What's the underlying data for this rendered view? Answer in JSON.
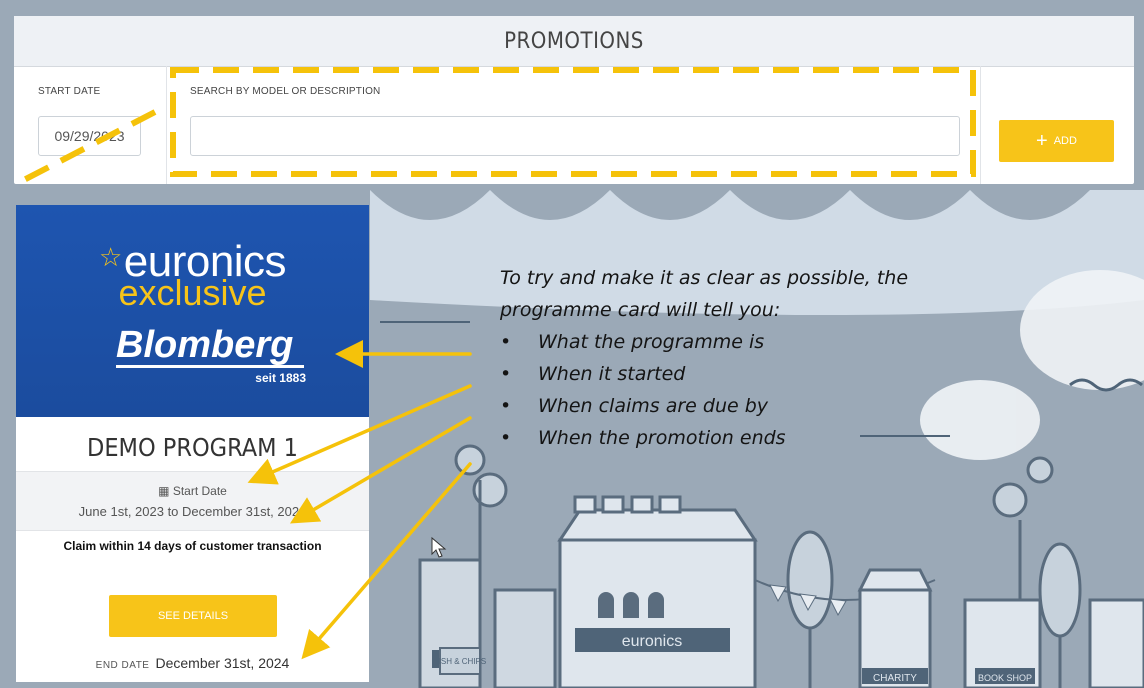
{
  "header": {
    "title": "PROMOTIONS"
  },
  "filters": {
    "start_date_label": "START DATE",
    "start_date_value": "09/29/2023",
    "search_label": "SEARCH BY MODEL OR DESCRIPTION",
    "search_value": "",
    "add_label": "ADD"
  },
  "card": {
    "brand": {
      "line1": "euronics",
      "line2": "exclusive",
      "line3": "Blomberg",
      "line4": "seit 1883"
    },
    "title": "DEMO PROGRAM 1",
    "start_label": "Start Date",
    "start_range": "June 1st, 2023 to December 31st, 2024",
    "claim_text": "Claim within 14 days of customer transaction",
    "details_label": "SEE DETAILS",
    "end_label": "END DATE",
    "end_date": "December 31st, 2024"
  },
  "annotation": {
    "intro_line1": "To try and make it as clear as possible, the",
    "intro_line2": "programme card will tell you:",
    "bullets": [
      "What the programme is",
      "When it started",
      "When claims are due by",
      "When the promotion ends"
    ]
  },
  "background": {
    "store_sign": "euronics",
    "sign_charity": "CHARITY",
    "sign_book": "BOOK SHOP",
    "sign_fish": "FISH & CHIPS"
  },
  "colors": {
    "accent": "#f7c419",
    "brand_blue": "#1e55b0",
    "header_bg": "#eef1f5",
    "scene_bg": "#9aa8b6"
  }
}
